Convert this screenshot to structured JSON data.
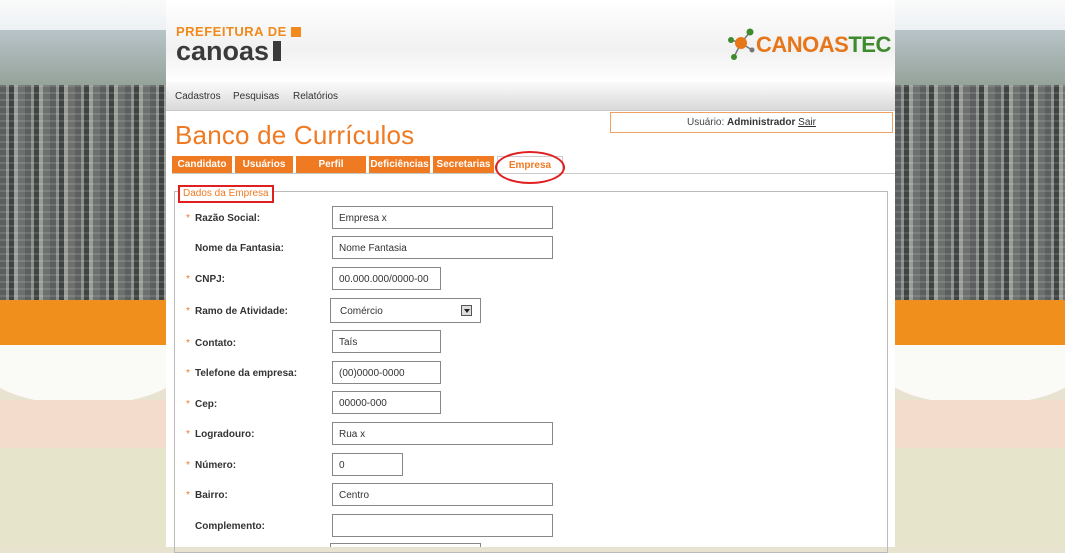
{
  "header": {
    "prefeitura_top": "PREFEITURA DE",
    "prefeitura_bottom": "canoas",
    "canoastec_part1": "CANOAS",
    "canoastec_part2": "TEC"
  },
  "nav": {
    "items": [
      "Cadastros",
      "Pesquisas",
      "Relatórios"
    ]
  },
  "user": {
    "label": "Usuário:",
    "name": "Administrador",
    "logout": "Sair"
  },
  "page_title": "Banco de Currículos",
  "tabs": [
    "Candidato",
    "Usuários",
    "Perfil",
    "Deficiências",
    "Secretarias",
    "Empresa"
  ],
  "active_tab": "Empresa",
  "form": {
    "legend": "Dados da Empresa",
    "required_mark": "*",
    "fields": [
      {
        "label": "Razão Social:",
        "value": "Empresa x",
        "required": true
      },
      {
        "label": "Nome da Fantasia:",
        "value": "Nome Fantasia",
        "required": false
      },
      {
        "label": "CNPJ:",
        "value": "00.000.000/0000-00",
        "required": true
      },
      {
        "label": "Ramo de Atividade:",
        "value": "Comércio",
        "required": true
      },
      {
        "label": "Contato:",
        "value": "Taís",
        "required": true
      },
      {
        "label": "Telefone da empresa:",
        "value": "(00)0000-0000",
        "required": true
      },
      {
        "label": "Cep:",
        "value": "00000-000",
        "required": true
      },
      {
        "label": "Logradouro:",
        "value": "Rua x",
        "required": true
      },
      {
        "label": "Número:",
        "value": "0",
        "required": true
      },
      {
        "label": "Bairro:",
        "value": "Centro",
        "required": true
      },
      {
        "label": "Complemento:",
        "value": "",
        "required": false
      }
    ]
  },
  "colors": {
    "accent": "#ef7a22",
    "highlight_ring": "#e02020",
    "brand_green": "#3d8b2d"
  }
}
